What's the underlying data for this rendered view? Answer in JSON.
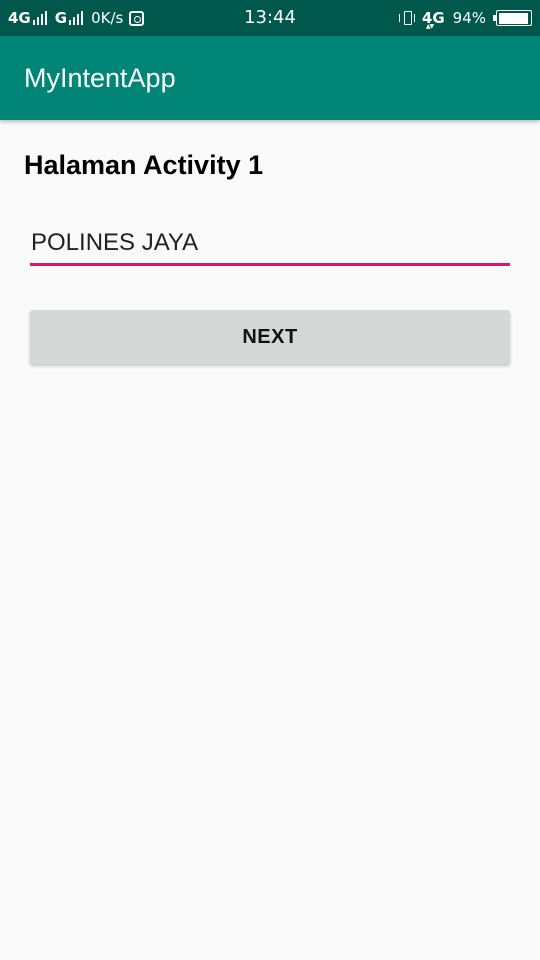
{
  "status_bar": {
    "network1": "4G",
    "network2": "G",
    "speed": "0K/s",
    "time": "13:44",
    "network3": "4G",
    "battery_percent": "94%",
    "battery_level": 0.94,
    "icons": [
      "signal-icon",
      "instagram-icon",
      "vibrate-icon",
      "battery-icon"
    ]
  },
  "app_bar": {
    "title": "MyIntentApp",
    "color": "#008577"
  },
  "main": {
    "heading": "Halaman Activity 1",
    "input_value": "POLINES JAYA",
    "input_accent": "#d81b60",
    "button_label": "NEXT"
  }
}
